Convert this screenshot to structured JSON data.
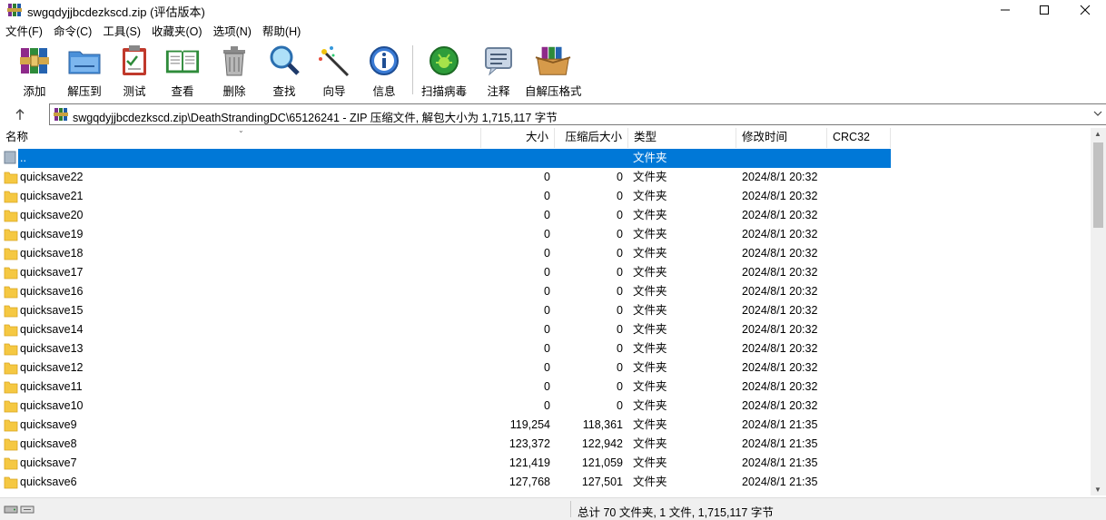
{
  "window": {
    "title": "swgqdyjjbcdezkscd.zip (评估版本)"
  },
  "menu": [
    {
      "label": "文件(F)"
    },
    {
      "label": "命令(C)"
    },
    {
      "label": "工具(S)"
    },
    {
      "label": "收藏夹(O)"
    },
    {
      "label": "选项(N)"
    },
    {
      "label": "帮助(H)"
    }
  ],
  "toolbar": [
    {
      "label": "添加",
      "icon": "add-archive-icon"
    },
    {
      "label": "解压到",
      "icon": "extract-folder-icon"
    },
    {
      "label": "测试",
      "icon": "test-clipboard-icon"
    },
    {
      "label": "查看",
      "icon": "view-book-icon"
    },
    {
      "label": "删除",
      "icon": "trash-icon"
    },
    {
      "label": "查找",
      "icon": "magnifier-icon"
    },
    {
      "label": "向导",
      "icon": "wizard-wand-icon"
    },
    {
      "label": "信息",
      "icon": "info-icon"
    },
    {
      "label": "扫描病毒",
      "icon": "virus-scan-icon"
    },
    {
      "label": "注释",
      "icon": "comment-icon"
    },
    {
      "label": "自解压格式",
      "icon": "sfx-box-icon"
    }
  ],
  "address": {
    "path": "swgqdyjjbcdezkscd.zip\\DeathStrandingDC\\65126241 - ZIP 压缩文件, 解包大小为 1,715,117 字节"
  },
  "columns": {
    "name": "名称",
    "size": "大小",
    "packed": "压缩后大小",
    "type": "类型",
    "mtime": "修改时间",
    "crc": "CRC32"
  },
  "parent_row": {
    "name": "..",
    "type": "文件夹"
  },
  "rows": [
    {
      "name": "quicksave22",
      "size": "0",
      "packed": "0",
      "type": "文件夹",
      "mtime": "2024/8/1 20:32"
    },
    {
      "name": "quicksave21",
      "size": "0",
      "packed": "0",
      "type": "文件夹",
      "mtime": "2024/8/1 20:32"
    },
    {
      "name": "quicksave20",
      "size": "0",
      "packed": "0",
      "type": "文件夹",
      "mtime": "2024/8/1 20:32"
    },
    {
      "name": "quicksave19",
      "size": "0",
      "packed": "0",
      "type": "文件夹",
      "mtime": "2024/8/1 20:32"
    },
    {
      "name": "quicksave18",
      "size": "0",
      "packed": "0",
      "type": "文件夹",
      "mtime": "2024/8/1 20:32"
    },
    {
      "name": "quicksave17",
      "size": "0",
      "packed": "0",
      "type": "文件夹",
      "mtime": "2024/8/1 20:32"
    },
    {
      "name": "quicksave16",
      "size": "0",
      "packed": "0",
      "type": "文件夹",
      "mtime": "2024/8/1 20:32"
    },
    {
      "name": "quicksave15",
      "size": "0",
      "packed": "0",
      "type": "文件夹",
      "mtime": "2024/8/1 20:32"
    },
    {
      "name": "quicksave14",
      "size": "0",
      "packed": "0",
      "type": "文件夹",
      "mtime": "2024/8/1 20:32"
    },
    {
      "name": "quicksave13",
      "size": "0",
      "packed": "0",
      "type": "文件夹",
      "mtime": "2024/8/1 20:32"
    },
    {
      "name": "quicksave12",
      "size": "0",
      "packed": "0",
      "type": "文件夹",
      "mtime": "2024/8/1 20:32"
    },
    {
      "name": "quicksave11",
      "size": "0",
      "packed": "0",
      "type": "文件夹",
      "mtime": "2024/8/1 20:32"
    },
    {
      "name": "quicksave10",
      "size": "0",
      "packed": "0",
      "type": "文件夹",
      "mtime": "2024/8/1 20:32"
    },
    {
      "name": "quicksave9",
      "size": "119,254",
      "packed": "118,361",
      "type": "文件夹",
      "mtime": "2024/8/1 21:35"
    },
    {
      "name": "quicksave8",
      "size": "123,372",
      "packed": "122,942",
      "type": "文件夹",
      "mtime": "2024/8/1 21:35"
    },
    {
      "name": "quicksave7",
      "size": "121,419",
      "packed": "121,059",
      "type": "文件夹",
      "mtime": "2024/8/1 21:35"
    },
    {
      "name": "quicksave6",
      "size": "127,768",
      "packed": "127,501",
      "type": "文件夹",
      "mtime": "2024/8/1 21:35"
    }
  ],
  "status": {
    "text": "总计 70 文件夹, 1 文件, 1,715,117 字节"
  },
  "colors": {
    "selection": "#0078d7",
    "folder": "#f5c842"
  }
}
